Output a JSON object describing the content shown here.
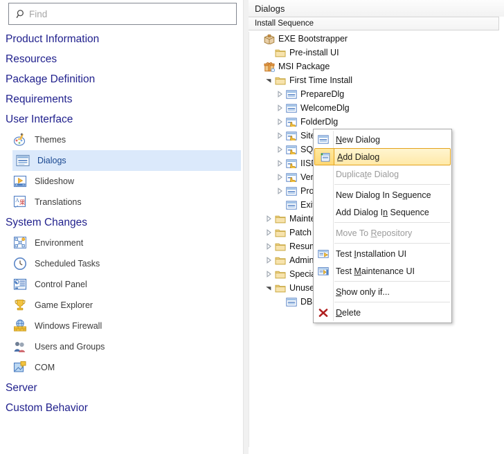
{
  "search": {
    "value": "",
    "placeholder": "Find",
    "icon": "search-icon"
  },
  "sidebar": {
    "groups": [
      {
        "header": "Product Information",
        "items": []
      },
      {
        "header": "Resources",
        "items": []
      },
      {
        "header": "Package Definition",
        "items": []
      },
      {
        "header": "Requirements",
        "items": []
      },
      {
        "header": "User Interface",
        "items": [
          {
            "label": "Themes",
            "icon": "palette-icon",
            "selected": false
          },
          {
            "label": "Dialogs",
            "icon": "dialog-window-icon",
            "selected": true
          },
          {
            "label": "Slideshow",
            "icon": "play-media-icon",
            "selected": false
          },
          {
            "label": "Translations",
            "icon": "translate-icon",
            "selected": false
          }
        ]
      },
      {
        "header": "System Changes",
        "items": [
          {
            "label": "Environment",
            "icon": "environment-nodes-icon",
            "selected": false
          },
          {
            "label": "Scheduled Tasks",
            "icon": "clock-icon",
            "selected": false
          },
          {
            "label": "Control Panel",
            "icon": "control-panel-icon",
            "selected": false
          },
          {
            "label": "Game Explorer",
            "icon": "trophy-icon",
            "selected": false
          },
          {
            "label": "Windows Firewall",
            "icon": "firewall-icon",
            "selected": false
          },
          {
            "label": "Users and Groups",
            "icon": "users-icon",
            "selected": false
          },
          {
            "label": "COM",
            "icon": "com-icon",
            "selected": false
          }
        ]
      },
      {
        "header": "Server",
        "items": []
      },
      {
        "header": "Custom Behavior",
        "items": []
      }
    ]
  },
  "right_panel": {
    "title": "Dialogs",
    "sequence_bar": "Install Sequence",
    "tree": [
      {
        "label": "EXE Bootstrapper",
        "icon": "package-box-icon",
        "indent": 0,
        "expander": "none"
      },
      {
        "label": "Pre-install UI",
        "icon": "folder-icon",
        "indent": 1,
        "expander": "none"
      },
      {
        "label": "MSI Package",
        "icon": "msi-package-icon",
        "indent": 0,
        "expander": "none"
      },
      {
        "label": "First Time Install",
        "icon": "folder-icon",
        "indent": 1,
        "expander": "expanded"
      },
      {
        "label": "PrepareDlg",
        "icon": "dialog-icon",
        "indent": 2,
        "expander": "collapsed"
      },
      {
        "label": "WelcomeDlg",
        "icon": "dialog-icon",
        "indent": 2,
        "expander": "collapsed"
      },
      {
        "label": "FolderDlg",
        "icon": "custom-dialog-icon",
        "indent": 2,
        "expander": "collapsed"
      },
      {
        "label": "SiteM",
        "icon": "custom-dialog-icon",
        "indent": 2,
        "expander": "collapsed"
      },
      {
        "label": "SQL",
        "icon": "custom-dialog-icon",
        "indent": 2,
        "expander": "collapsed"
      },
      {
        "label": "IISD",
        "icon": "custom-dialog-icon",
        "indent": 2,
        "expander": "collapsed"
      },
      {
        "label": "Verit",
        "icon": "custom-dialog-icon",
        "indent": 2,
        "expander": "collapsed"
      },
      {
        "label": "Prog",
        "icon": "dialog-icon",
        "indent": 2,
        "expander": "collapsed"
      },
      {
        "label": "ExitD",
        "icon": "dialog-icon",
        "indent": 2,
        "expander": "none"
      },
      {
        "label": "Mainten",
        "icon": "folder-icon",
        "indent": 1,
        "expander": "collapsed"
      },
      {
        "label": "Patch",
        "icon": "folder-icon",
        "indent": 1,
        "expander": "collapsed"
      },
      {
        "label": "Resume",
        "icon": "folder-icon",
        "indent": 1,
        "expander": "collapsed"
      },
      {
        "label": "Adminis",
        "icon": "folder-icon",
        "indent": 1,
        "expander": "collapsed"
      },
      {
        "label": "Special",
        "icon": "folder-icon",
        "indent": 1,
        "expander": "collapsed"
      },
      {
        "label": "Unused",
        "icon": "folder-icon",
        "indent": 1,
        "expander": "expanded"
      },
      {
        "label": "DBD",
        "icon": "dialog-icon",
        "indent": 2,
        "expander": "none"
      }
    ]
  },
  "context_menu": {
    "items": [
      {
        "label": "New Dialog",
        "accel": "N",
        "icon": "dialog-icon",
        "state": "normal"
      },
      {
        "label": "Add Dialog",
        "accel": "A",
        "icon": "add-dialog-icon",
        "state": "highlight"
      },
      {
        "label": "Duplicate Dialog",
        "accel": "t",
        "icon": "none",
        "state": "disabled"
      },
      {
        "separator": true
      },
      {
        "label": "New Dialog In Sequence",
        "accel": "q",
        "icon": "none",
        "state": "normal"
      },
      {
        "label": "Add Dialog In Sequence",
        "accel": "n",
        "icon": "none",
        "state": "normal"
      },
      {
        "separator": true
      },
      {
        "label": "Move To Repository",
        "accel": "R",
        "icon": "none",
        "state": "disabled"
      },
      {
        "separator": true
      },
      {
        "label": "Test Installation UI",
        "accel": "I",
        "icon": "test-install-ui-icon",
        "state": "normal"
      },
      {
        "label": "Test Maintenance UI",
        "accel": "M",
        "icon": "test-maintenance-ui-icon",
        "state": "normal"
      },
      {
        "separator": true
      },
      {
        "label": "Show only if...",
        "accel": "S",
        "icon": "none",
        "state": "normal"
      },
      {
        "separator": true
      },
      {
        "label": "Delete",
        "accel": "D",
        "icon": "delete-x-icon",
        "state": "normal"
      }
    ]
  },
  "colors": {
    "nav_header": "#1f1f8c",
    "selection": "#dbe9fb",
    "menu_highlight_border": "#e3a21a",
    "delete_icon": "#b02020"
  }
}
